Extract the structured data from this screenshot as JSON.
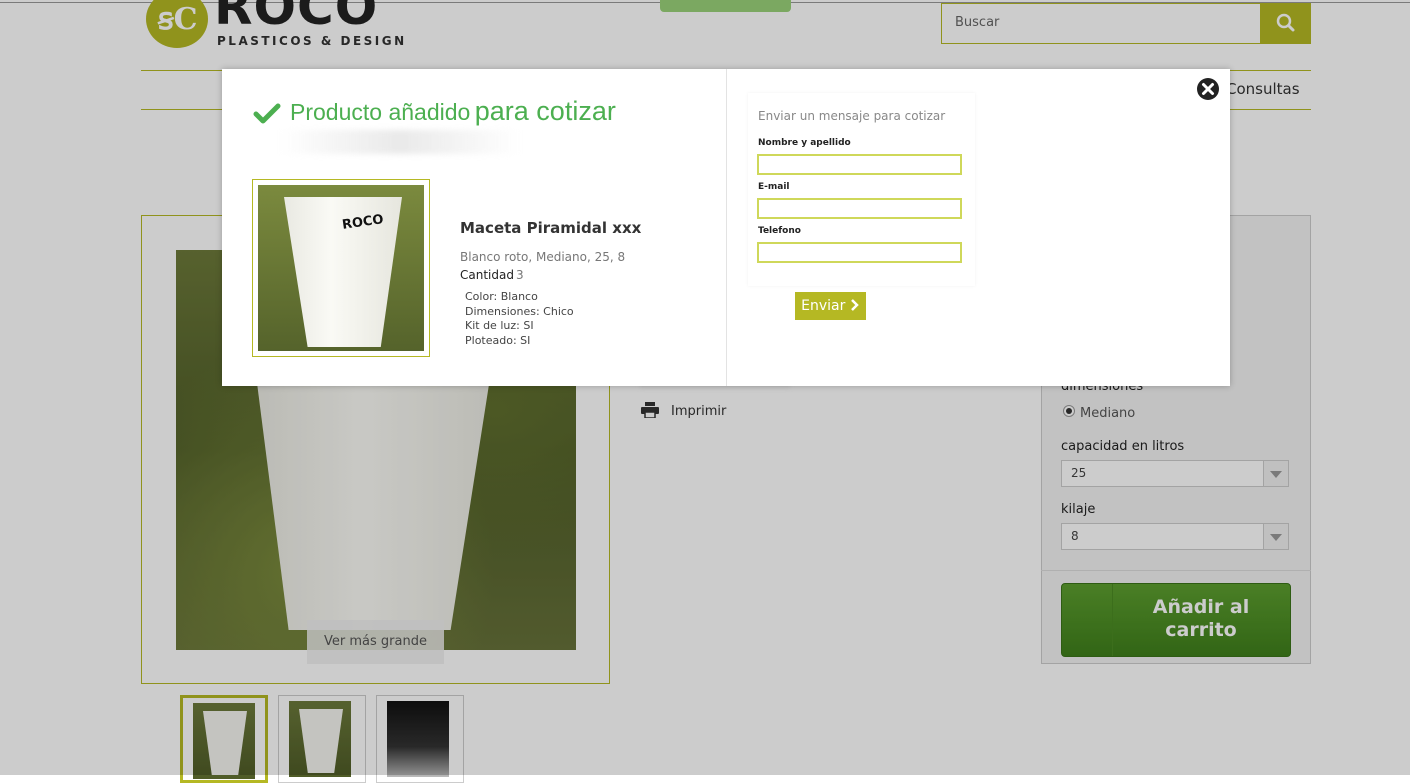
{
  "header": {
    "logo_monogram": "ꞩC",
    "logo_word": "ROCO",
    "logo_sub": "PLASTICOS & DESIGN",
    "search_placeholder": "Buscar",
    "nav_consultas": "Consultas"
  },
  "product_page": {
    "ver_mas_grande": "Ver más grande",
    "imprimir": "Imprimir",
    "options": {
      "dimensiones_label": "dimensiones",
      "dimensiones_value": "Mediano",
      "capacidad_label": "capacidad en litros",
      "capacidad_value": "25",
      "kilaje_label": "kilaje",
      "kilaje_value": "8"
    },
    "cart_icon": "",
    "cart_label": "Añadir al\ncarrito"
  },
  "modal": {
    "title_part1": "Producto añadido",
    "title_part2": "para cotizar",
    "product_name": "Maceta Piramidal xxx",
    "variant": "Blanco roto, Mediano, 25, 8",
    "quantity_label": "Cantidad",
    "quantity_value": "3",
    "attributes": [
      "Color: Blanco",
      "Dimensiones: Chico",
      "Kit de luz: SI",
      "Ploteado: SI"
    ],
    "form": {
      "title": "Enviar un mensaje para cotizar",
      "name_label": "Nombre y apellido",
      "email_label": "E-mail",
      "phone_label": "Telefono",
      "send_label": "Enviar"
    }
  },
  "colors": {
    "brand_olive": "#b5b823",
    "title_green": "#4caf50",
    "cart_green": "#4e8f25"
  }
}
